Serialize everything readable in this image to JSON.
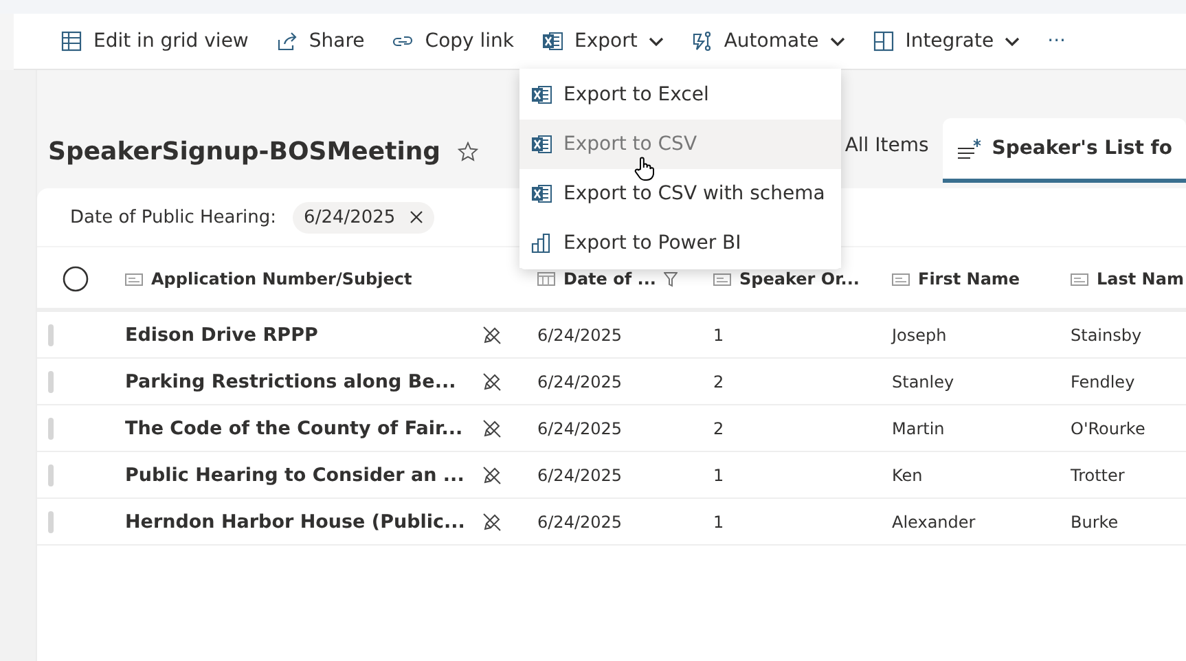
{
  "toolbar": [
    {
      "label": "Edit in grid view",
      "kind": "button"
    },
    {
      "label": "Share",
      "kind": "button"
    },
    {
      "label": "Copy link",
      "kind": "button"
    },
    {
      "label": "Export",
      "kind": "dropdown"
    },
    {
      "label": "Automate",
      "kind": "dropdown"
    },
    {
      "label": "Integrate",
      "kind": "dropdown"
    },
    {
      "label": "···",
      "kind": "more"
    }
  ],
  "export_menu": [
    {
      "label": "Export to Excel",
      "kind": "spreadsheet",
      "highlighted": false
    },
    {
      "label": "Export to CSV",
      "kind": "spreadsheet",
      "highlighted": true
    },
    {
      "label": "Export to CSV with schema",
      "kind": "spreadsheet",
      "highlighted": false
    },
    {
      "label": "Export to Power BI",
      "kind": "report",
      "highlighted": false
    }
  ],
  "list_title": "SpeakerSignup-BOSMeeting",
  "favorite": false,
  "views": [
    {
      "label": "All Items",
      "selected": false
    },
    {
      "label": "Speaker's List fo",
      "selected": true
    }
  ],
  "filter": {
    "label": "Date of Public Hearing:",
    "value": "6/24/2025"
  },
  "table": {
    "select_all_checked": false,
    "columns": [
      {
        "label": "Application Number/Subject",
        "kind": "text"
      },
      {
        "label": "Date of ...",
        "kind": "date",
        "filtered": true
      },
      {
        "label": "Speaker Or...",
        "kind": "text"
      },
      {
        "label": "First Name",
        "kind": "text"
      },
      {
        "label": "Last Nam",
        "kind": "text"
      }
    ],
    "rows": [
      {
        "cells": [
          "Edison Drive RPPP",
          "6/24/2025",
          "1",
          "Joseph",
          "Stainsby"
        ]
      },
      {
        "cells": [
          "Parking Restrictions along Be...",
          "6/24/2025",
          "2",
          "Stanley",
          "Fendley"
        ]
      },
      {
        "cells": [
          "The Code of the County of Fair...",
          "6/24/2025",
          "2",
          "Martin",
          "O'Rourke"
        ]
      },
      {
        "cells": [
          "Public Hearing to Consider an ...",
          "6/24/2025",
          "1",
          "Ken",
          "Trotter"
        ]
      },
      {
        "cells": [
          "Herndon Harbor House (Public...",
          "6/24/2025",
          "1",
          "Alexander",
          "Burke"
        ]
      }
    ]
  }
}
